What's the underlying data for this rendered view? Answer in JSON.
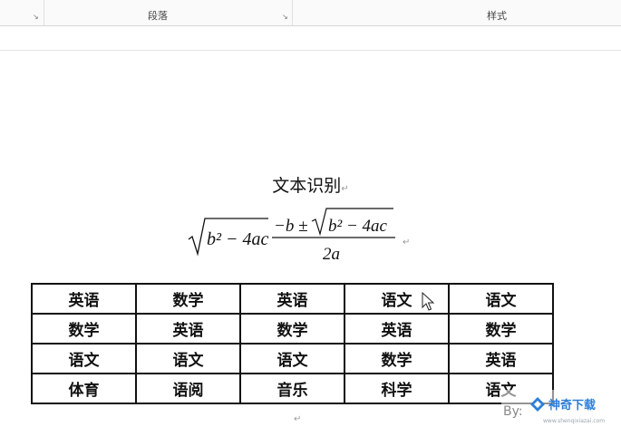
{
  "ribbon": {
    "paragraph_label": "段落",
    "styles_label": "样式",
    "launcher_glyph": "↘"
  },
  "document": {
    "heading": "文本识别",
    "para_mark": "↵",
    "formula": {
      "radical_left": "b² − 4ac",
      "numerator_prefix": "−b ±",
      "numerator_radical": "b² − 4ac",
      "denominator": "2a"
    },
    "table": [
      [
        "英语",
        "数学",
        "英语",
        "语文",
        "语文"
      ],
      [
        "数学",
        "英语",
        "数学",
        "英语",
        "数学"
      ],
      [
        "语文",
        "语文",
        "语文",
        "数学",
        "英语"
      ],
      [
        "体育",
        "语阅",
        "音乐",
        "科学",
        "语文"
      ]
    ]
  },
  "watermark": {
    "by": "By:",
    "brand": "神奇下载",
    "url": "www.shenqixiazai.com",
    "brand_color": "#2d7fd8"
  }
}
